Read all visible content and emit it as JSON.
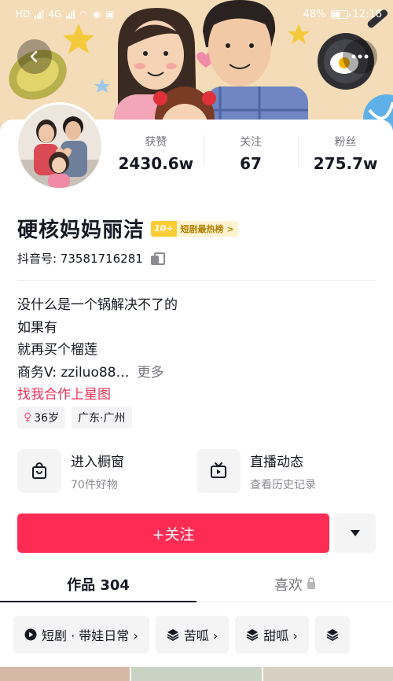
{
  "status_bar": {
    "signal_left": "HD",
    "signal_mid": "4G",
    "battery": "48%",
    "time": "12:16"
  },
  "cover": {
    "back_icon": "chevron-left-icon",
    "more_icon": "more-horizontal-icon"
  },
  "stats": [
    {
      "label": "获赞",
      "value": "2430.6w"
    },
    {
      "label": "关注",
      "value": "67"
    },
    {
      "label": "粉丝",
      "value": "275.7w"
    }
  ],
  "profile": {
    "name": "硬核妈妈丽洁",
    "rank_badge": {
      "rank": "10+",
      "label": "短剧最热榜 >"
    },
    "id_label": "抖音号: 73581716281",
    "bio_lines": [
      "没什么是一个锅解决不了的",
      "如果有",
      "就再买个榴莲"
    ],
    "biz_line": "商务V: zziluo88…",
    "more_label": "更多",
    "biz_link": "找我合作上星图",
    "tags": {
      "age": "36岁",
      "location": "广东·广州"
    }
  },
  "shortcuts": [
    {
      "title": "进入橱窗",
      "sub": "70件好物",
      "icon": "shopping-bag-icon"
    },
    {
      "title": "直播动态",
      "sub": "查看历史记录",
      "icon": "tv-icon"
    }
  ],
  "actions": {
    "follow": "+关注"
  },
  "tabs": {
    "works": "作品 304",
    "likes": "喜欢"
  },
  "chips": [
    {
      "label": "短剧 · 带娃日常 ›",
      "icon": "play-icon"
    },
    {
      "label": "苦呱 ›",
      "icon": "layers-icon"
    },
    {
      "label": "甜呱 ›",
      "icon": "layers-icon"
    }
  ],
  "colors": {
    "accent": "#fe2c55",
    "link": "#ef2e55",
    "badge": "#ffcc33"
  }
}
